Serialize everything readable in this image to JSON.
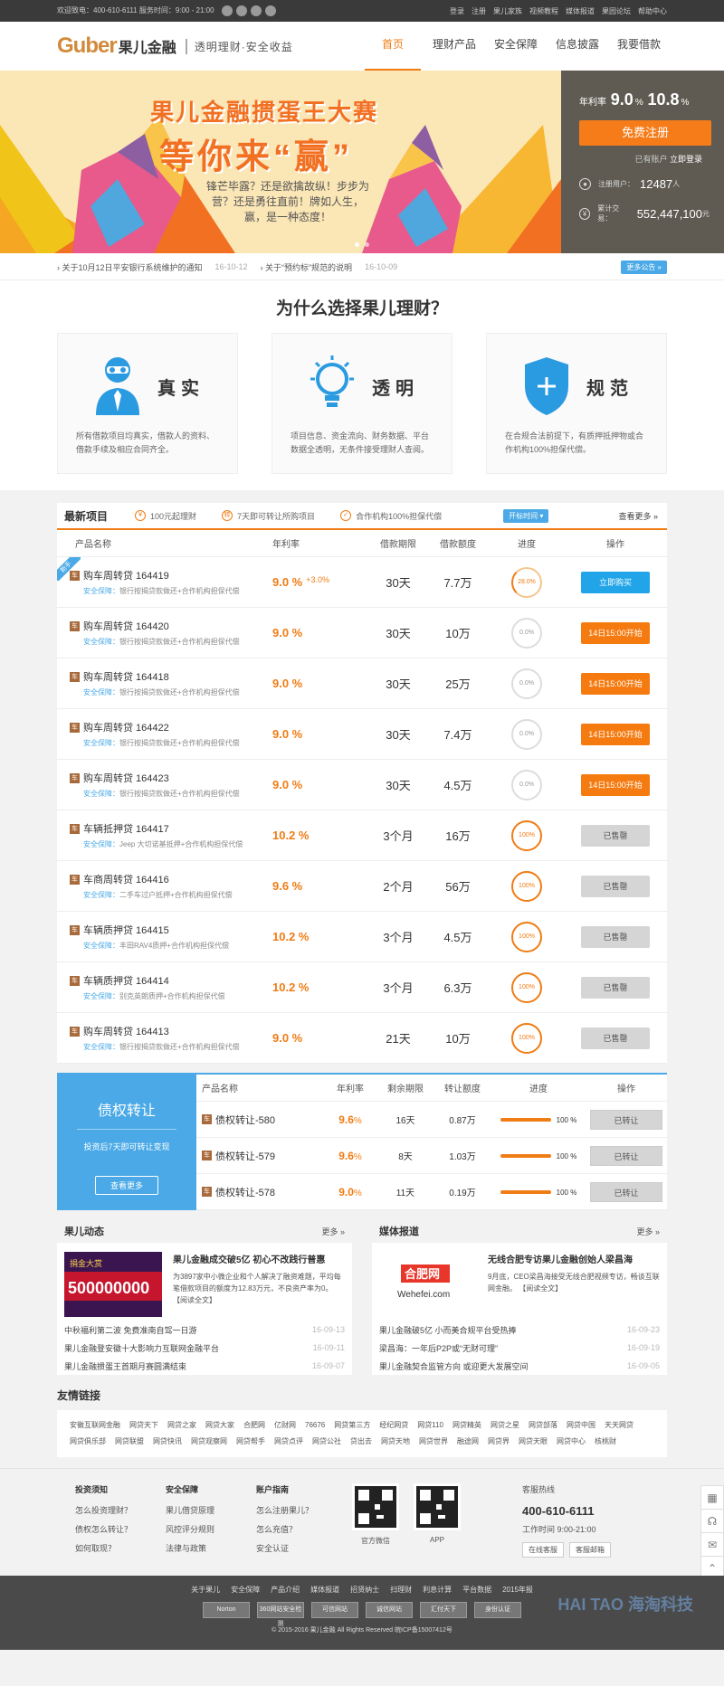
{
  "topbar": {
    "hotline": "欢迎致电：400-610-6111 服务时间：9:00 - 21:00",
    "links": [
      "登录",
      "注册",
      "果儿家族",
      "视频教程",
      "媒体报道",
      "果园论坛",
      "帮助中心"
    ]
  },
  "logo": {
    "en": "Guber",
    "cn": "果儿金融",
    "slogan": "透明理财·安全收益"
  },
  "nav": [
    "首页",
    "理财产品",
    "安全保障",
    "信息披露",
    "我要借款"
  ],
  "banner": {
    "title": "果儿金融掼蛋王大赛",
    "sub": "等你来“赢”",
    "poem": "锋芒毕露？还是欲擒故纵！步步为营？还是勇往直前！牌如人生，赢，是一种态度！",
    "rate_label": "年利率",
    "rate_low": "9.0",
    "rate_high": "10.8",
    "rate_unit": "%",
    "register": "免费注册",
    "has_account": "已有账户",
    "login_now": "立即登录",
    "users_label": "注册用户：",
    "users": "12487",
    "users_unit": "人",
    "volume_label": "累计交易：",
    "volume": "552,447,100",
    "volume_unit": "元"
  },
  "notice": {
    "items": [
      {
        "text": "关于10月12日平安银行系统维护的通知",
        "date": "16-10-12"
      },
      {
        "text": "关于“预约标”规范的说明",
        "date": "16-10-09"
      }
    ],
    "more": "更多公告 »"
  },
  "why": {
    "title": "为什么选择果儿理财？",
    "cards": [
      {
        "name": "真实",
        "desc": "所有借款项目均真实，借款人的资料、借款手续及相应合同齐全。"
      },
      {
        "name": "透明",
        "desc": "项目信息、资金流向、财务数据、平台数据全透明，无条件接受理财人查阅。"
      },
      {
        "name": "规范",
        "desc": "在合规合法前提下，有质押抵押物或合作机构100%担保代偿。"
      }
    ]
  },
  "latest": {
    "title": "最新项目",
    "features": [
      "100元起理财",
      "7天即可转让所购项目",
      "合作机构100%担保代偿"
    ],
    "sort": "开标时间 ▾",
    "more": "查看更多 »",
    "columns": [
      "产品名称",
      "年利率",
      "借款期限",
      "借款额度",
      "进度",
      "操作"
    ],
    "new_tag": "新手",
    "rows": [
      {
        "tag": "车",
        "name": "购车周转贷 164419",
        "safe_label": "安全保障：",
        "safe": "银行按揭贷款做还+合作机构担保代偿",
        "rate": "9.0 %",
        "plus": "+3.0%",
        "term": "30天",
        "amount": "7.7万",
        "progress": "28.0%",
        "action": "立即购买",
        "style": "blue",
        "circle": "part"
      },
      {
        "tag": "车",
        "name": "购车周转贷 164420",
        "safe_label": "安全保障：",
        "safe": "银行按揭贷款做还+合作机构担保代偿",
        "rate": "9.0 %",
        "plus": "",
        "term": "30天",
        "amount": "10万",
        "progress": "0.0%",
        "action": "14日15:00开始",
        "style": "orange",
        "circle": "empty"
      },
      {
        "tag": "车",
        "name": "购车周转贷 164418",
        "safe_label": "安全保障：",
        "safe": "银行按揭贷款做还+合作机构担保代偿",
        "rate": "9.0 %",
        "plus": "",
        "term": "30天",
        "amount": "25万",
        "progress": "0.0%",
        "action": "14日15:00开始",
        "style": "orange",
        "circle": "empty"
      },
      {
        "tag": "车",
        "name": "购车周转贷 164422",
        "safe_label": "安全保障：",
        "safe": "银行按揭贷款做还+合作机构担保代偿",
        "rate": "9.0 %",
        "plus": "",
        "term": "30天",
        "amount": "7.4万",
        "progress": "0.0%",
        "action": "14日15:00开始",
        "style": "orange",
        "circle": "empty"
      },
      {
        "tag": "车",
        "name": "购车周转贷 164423",
        "safe_label": "安全保障：",
        "safe": "银行按揭贷款做还+合作机构担保代偿",
        "rate": "9.0 %",
        "plus": "",
        "term": "30天",
        "amount": "4.5万",
        "progress": "0.0%",
        "action": "14日15:00开始",
        "style": "orange",
        "circle": "empty"
      },
      {
        "tag": "车",
        "name": "车辆抵押贷 164417",
        "safe_label": "安全保障：",
        "safe": "Jeep 大切诺基抵押+合作机构担保代偿",
        "rate": "10.2 %",
        "plus": "",
        "term": "3个月",
        "amount": "16万",
        "progress": "100%",
        "action": "已售罄",
        "style": "gray",
        "circle": "full"
      },
      {
        "tag": "车",
        "name": "车商周转贷 164416",
        "safe_label": "安全保障：",
        "safe": "二手车过户抵押+合作机构担保代偿",
        "rate": "9.6 %",
        "plus": "",
        "term": "2个月",
        "amount": "56万",
        "progress": "100%",
        "action": "已售罄",
        "style": "gray",
        "circle": "full"
      },
      {
        "tag": "车",
        "name": "车辆质押贷 164415",
        "safe_label": "安全保障：",
        "safe": "丰田RAV4质押+合作机构担保代偿",
        "rate": "10.2 %",
        "plus": "",
        "term": "3个月",
        "amount": "4.5万",
        "progress": "100%",
        "action": "已售罄",
        "style": "gray",
        "circle": "full"
      },
      {
        "tag": "车",
        "name": "车辆质押贷 164414",
        "safe_label": "安全保障：",
        "safe": "别克英朗质押+合作机构担保代偿",
        "rate": "10.2 %",
        "plus": "",
        "term": "3个月",
        "amount": "6.3万",
        "progress": "100%",
        "action": "已售罄",
        "style": "gray",
        "circle": "full"
      },
      {
        "tag": "车",
        "name": "购车周转贷 164413",
        "safe_label": "安全保障：",
        "safe": "银行按揭贷款做还+合作机构担保代偿",
        "rate": "9.0 %",
        "plus": "",
        "term": "21天",
        "amount": "10万",
        "progress": "100%",
        "action": "已售罄",
        "style": "gray",
        "circle": "full"
      }
    ]
  },
  "transfer": {
    "title": "债权转让",
    "sub": "投资后7天即可转让变现",
    "more": "查看更多",
    "columns": [
      "产品名称",
      "年利率",
      "剩余期限",
      "转让额度",
      "进度",
      "操作"
    ],
    "rows": [
      {
        "tag": "车",
        "name": "债权转让-580",
        "rate": "9.6",
        "unit": "%",
        "term": "16天",
        "amount": "0.87万",
        "progress": "100 %",
        "action": "已转让"
      },
      {
        "tag": "车",
        "name": "债权转让-579",
        "rate": "9.6",
        "unit": "%",
        "term": "8天",
        "amount": "1.03万",
        "progress": "100 %",
        "action": "已转让"
      },
      {
        "tag": "车",
        "name": "债权转让-578",
        "rate": "9.0",
        "unit": "%",
        "term": "11天",
        "amount": "0.19万",
        "progress": "100 %",
        "action": "已转让"
      }
    ]
  },
  "news": {
    "left": {
      "title": "果儿动态",
      "more": "更多 »",
      "img_text": "500000000",
      "img_label": "捐金大赏",
      "feat_title": "果儿金融成交破5亿 初心不改践行普惠",
      "feat_desc": "为3897家中小微企业和个人解决了融资难题，平均每笔借款项目的额度为12.83万元，不良资产率为0。",
      "read": "【阅读全文】",
      "list": [
        {
          "t": "中秋福利第二波 免费准南自驾一日游",
          "d": "16-09-13"
        },
        {
          "t": "果儿金融登安徽十大影响力互联网金融平台",
          "d": "16-09-11"
        },
        {
          "t": "果儿金融掼蛋王首期月赛圆满结束",
          "d": "16-09-07"
        }
      ]
    },
    "right": {
      "title": "媒体报道",
      "more": "更多 »",
      "img_text": "合肥网",
      "img_sub": "Wehefei.com",
      "feat_title": "无线合肥专访果儿金融创始人梁昌海",
      "feat_desc": "9月底，CEO梁昌海接受无线合肥视频专访，畅谈互联网金融。",
      "read": "【阅读全文】",
      "list": [
        {
          "t": "果儿金融破5亿 小而美合规平台受热捧",
          "d": "16-09-23"
        },
        {
          "t": "梁昌海：一年后P2P或“无财可理”",
          "d": "16-09-19"
        },
        {
          "t": "果儿金融契合监管方向 或迎更大发展空间",
          "d": "16-09-05"
        }
      ]
    }
  },
  "links": {
    "title": "友情链接",
    "items": [
      "安徽互联网金融",
      "网贷天下",
      "网贷之家",
      "网贷大家",
      "合肥网",
      "亿财网",
      "76676",
      "网贷第三方",
      "经纪网贷",
      "网贷110",
      "网贷精英",
      "网贷之星",
      "网贷部落",
      "网贷中国",
      "天天网贷",
      "网贷俱乐部",
      "网贷联盟",
      "网贷快讯",
      "网贷观察网",
      "网贷帮手",
      "网贷点评",
      "网贷公社",
      "贷出去",
      "网贷天地",
      "网贷世界",
      "融途网",
      "网贷界",
      "网贷天眼",
      "网贷中心",
      "核桃财"
    ]
  },
  "side_tools": [
    "▦",
    "☊",
    "✉",
    "⌃"
  ],
  "footer": {
    "cols": [
      {
        "h": "投资须知",
        "items": [
          "怎么投资理财？",
          "债权怎么转让？",
          "如何取现？"
        ]
      },
      {
        "h": "安全保障",
        "items": [
          "果儿借贷原理",
          "风控评分规则",
          "法律与政策"
        ]
      },
      {
        "h": "账户指南",
        "items": [
          "怎么注册果儿？",
          "怎么充值？",
          "安全认证"
        ]
      }
    ],
    "qr": [
      "官方微信",
      "APP"
    ],
    "hot_title": "客服热线",
    "tel": "400-610-6111",
    "hours": "工作时间 9:00-21:00",
    "online": "在线客服",
    "email": "客服邮箱"
  },
  "bottom": {
    "links": [
      "关于果儿",
      "安全保障",
      "产品介绍",
      "媒体报道",
      "招贤纳士",
      "扫理财",
      "利息计算",
      "平台数据",
      "2015年报"
    ],
    "badges": [
      "Norton",
      "360网站安全检测",
      "可信网站",
      "诚信网站",
      "汇付天下",
      "身份认证"
    ],
    "copyright": "© 2015-2016 果儿金融 All Rights Reserved 皖ICP备15007412号",
    "watermark": "HAI TAO 海淘科技"
  }
}
